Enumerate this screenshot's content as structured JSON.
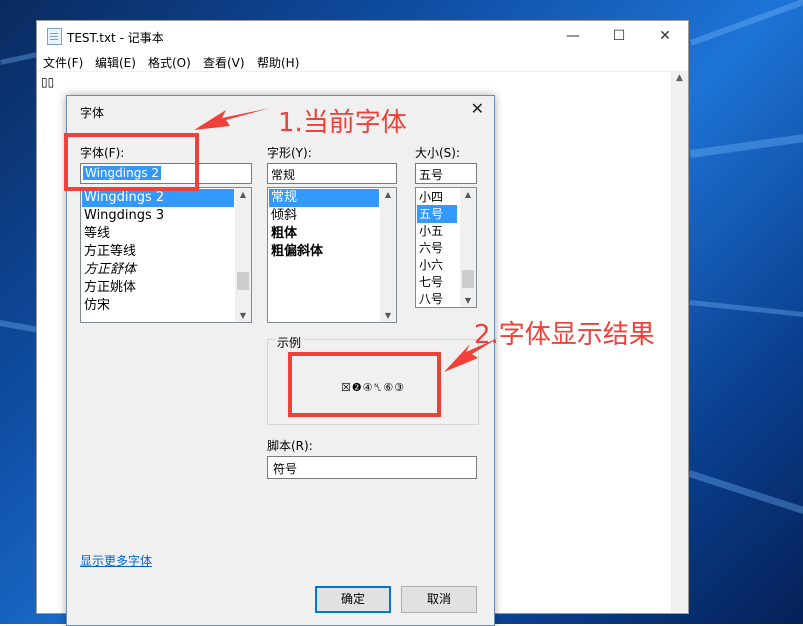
{
  "notepad": {
    "title": "TEST.txt - 记事本",
    "menu": [
      "文件(F)",
      "编辑(E)",
      "格式(O)",
      "查看(V)",
      "帮助(H)"
    ],
    "content": "▯▯",
    "window_controls": {
      "minimize": "—",
      "maximize": "☐",
      "close": "✕"
    }
  },
  "dialog": {
    "title": "字体",
    "close": "✕",
    "font": {
      "label": "字体(F):",
      "value": "Wingdings 2",
      "items": [
        "Wingdings 2",
        "Wingdings 3",
        "等线",
        "方正等线",
        "方正舒体",
        "方正姚体",
        "仿宋"
      ],
      "selected_index": 0
    },
    "style": {
      "label": "字形(Y):",
      "value": "常规",
      "items": [
        "常规",
        "倾斜",
        "粗体",
        "粗偏斜体"
      ],
      "selected_index": 0
    },
    "size": {
      "label": "大小(S):",
      "value": "五号",
      "items": [
        "小四",
        "五号",
        "小五",
        "六号",
        "小六",
        "七号",
        "八号"
      ],
      "selected_index": 1
    },
    "sample": {
      "label": "示例",
      "text": "☒❷④␤⑥③"
    },
    "script": {
      "label": "脚本(R):",
      "value": "符号"
    },
    "more_fonts_link": "显示更多字体",
    "ok_label": "确定",
    "cancel_label": "取消"
  },
  "annotations": {
    "current_font": "1.当前字体",
    "font_result": "2.字体显示结果",
    "color": "#f0403a"
  },
  "scroll_arrows": {
    "up": "▲",
    "down": "▼",
    "dropdown": "⌵"
  }
}
